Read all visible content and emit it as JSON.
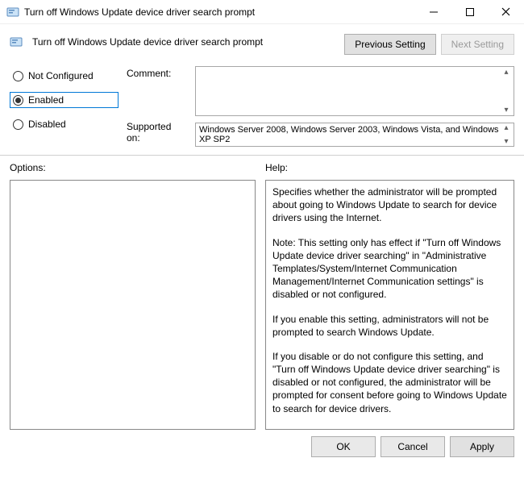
{
  "window": {
    "title": "Turn off Windows Update device driver search prompt"
  },
  "header": {
    "title": "Turn off Windows Update device driver search prompt",
    "prev_btn": "Previous Setting",
    "next_btn": "Next Setting"
  },
  "radios": {
    "not_configured": "Not Configured",
    "enabled": "Enabled",
    "disabled": "Disabled",
    "selected": "enabled"
  },
  "labels": {
    "comment": "Comment:",
    "supported": "Supported on:",
    "options": "Options:",
    "help": "Help:"
  },
  "fields": {
    "comment": "",
    "supported": "Windows Server 2008, Windows Server 2003, Windows Vista, and Windows XP SP2"
  },
  "help": {
    "p1": "Specifies whether the administrator will be prompted about going to Windows Update to search for device drivers using the Internet.",
    "p2": "Note: This setting only has effect if \"Turn off Windows Update device driver searching\" in \"Administrative Templates/System/Internet Communication Management/Internet Communication settings\" is disabled or not configured.",
    "p3": "If you enable this setting, administrators will not be prompted to search Windows Update.",
    "p4": "If you disable or do not configure this setting, and \"Turn off Windows Update device driver searching\" is disabled or not configured, the administrator will be prompted for consent before going to Windows Update to search for device drivers."
  },
  "footer": {
    "ok": "OK",
    "cancel": "Cancel",
    "apply": "Apply"
  }
}
